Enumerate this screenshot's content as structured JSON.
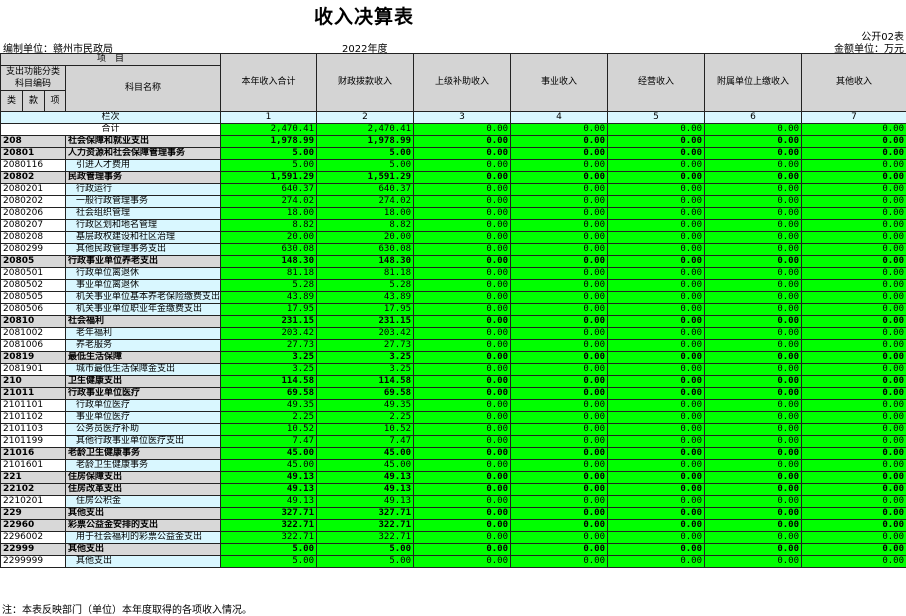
{
  "title": "收入决算表",
  "form_no": "公开02表",
  "meta": {
    "unit": "编制单位：赣州市民政局",
    "year": "2022年度",
    "money_unit": "金额单位：万元"
  },
  "header": {
    "project": "项　目",
    "func_class": "支出功能分类科目编码",
    "subject_name": "科目名称",
    "lei": "类",
    "kuan": "款",
    "xiang": "项",
    "index_label": "栏次",
    "total_label": "合计",
    "columns": [
      "本年收入合计",
      "财政拨款收入",
      "上级补助收入",
      "事业收入",
      "经营收入",
      "附属单位上缴收入",
      "其他收入"
    ],
    "index_numbers": [
      "1",
      "2",
      "3",
      "4",
      "5",
      "6",
      "7"
    ]
  },
  "total_row": {
    "v1": "2,470.41",
    "v2": "2,470.41",
    "v3": "0.00",
    "v4": "0.00",
    "v5": "0.00",
    "v6": "0.00",
    "v7": "0.00"
  },
  "rows": [
    {
      "code": "208",
      "name": "社会保障和就业支出",
      "v1": "1,978.99",
      "v2": "1,978.99",
      "cat": true
    },
    {
      "code": "20801",
      "name": "人力资源和社会保障管理事务",
      "v1": "5.00",
      "v2": "5.00",
      "cat": true
    },
    {
      "code": "2080116",
      "name": "引进人才费用",
      "v1": "5.00",
      "v2": "5.00",
      "cat": false
    },
    {
      "code": "20802",
      "name": "民政管理事务",
      "v1": "1,591.29",
      "v2": "1,591.29",
      "cat": true
    },
    {
      "code": "2080201",
      "name": "行政运行",
      "v1": "640.37",
      "v2": "640.37",
      "cat": false
    },
    {
      "code": "2080202",
      "name": "一般行政管理事务",
      "v1": "274.02",
      "v2": "274.02",
      "cat": false
    },
    {
      "code": "2080206",
      "name": "社会组织管理",
      "v1": "18.00",
      "v2": "18.00",
      "cat": false
    },
    {
      "code": "2080207",
      "name": "行政区划和地名管理",
      "v1": "8.82",
      "v2": "8.82",
      "cat": false
    },
    {
      "code": "2080208",
      "name": "基层政权建设和社区治理",
      "v1": "20.00",
      "v2": "20.00",
      "cat": false
    },
    {
      "code": "2080299",
      "name": "其他民政管理事务支出",
      "v1": "630.08",
      "v2": "630.08",
      "cat": false
    },
    {
      "code": "20805",
      "name": "行政事业单位养老支出",
      "v1": "148.30",
      "v2": "148.30",
      "cat": true
    },
    {
      "code": "2080501",
      "name": "行政单位离退休",
      "v1": "81.18",
      "v2": "81.18",
      "cat": false
    },
    {
      "code": "2080502",
      "name": "事业单位离退休",
      "v1": "5.28",
      "v2": "5.28",
      "cat": false
    },
    {
      "code": "2080505",
      "name": "机关事业单位基本养老保险缴费支出",
      "v1": "43.89",
      "v2": "43.89",
      "cat": false
    },
    {
      "code": "2080506",
      "name": "机关事业单位职业年金缴费支出",
      "v1": "17.95",
      "v2": "17.95",
      "cat": false
    },
    {
      "code": "20810",
      "name": "社会福利",
      "v1": "231.15",
      "v2": "231.15",
      "cat": true
    },
    {
      "code": "2081002",
      "name": "老年福利",
      "v1": "203.42",
      "v2": "203.42",
      "cat": false
    },
    {
      "code": "2081006",
      "name": "养老服务",
      "v1": "27.73",
      "v2": "27.73",
      "cat": false
    },
    {
      "code": "20819",
      "name": "最低生活保障",
      "v1": "3.25",
      "v2": "3.25",
      "cat": true
    },
    {
      "code": "2081901",
      "name": "城市最低生活保障金支出",
      "v1": "3.25",
      "v2": "3.25",
      "cat": false
    },
    {
      "code": "210",
      "name": "卫生健康支出",
      "v1": "114.58",
      "v2": "114.58",
      "cat": true
    },
    {
      "code": "21011",
      "name": "行政事业单位医疗",
      "v1": "69.58",
      "v2": "69.58",
      "cat": true
    },
    {
      "code": "2101101",
      "name": "行政单位医疗",
      "v1": "49.35",
      "v2": "49.35",
      "cat": false
    },
    {
      "code": "2101102",
      "name": "事业单位医疗",
      "v1": "2.25",
      "v2": "2.25",
      "cat": false
    },
    {
      "code": "2101103",
      "name": "公务员医疗补助",
      "v1": "10.52",
      "v2": "10.52",
      "cat": false
    },
    {
      "code": "2101199",
      "name": "其他行政事业单位医疗支出",
      "v1": "7.47",
      "v2": "7.47",
      "cat": false
    },
    {
      "code": "21016",
      "name": "老龄卫生健康事务",
      "v1": "45.00",
      "v2": "45.00",
      "cat": true
    },
    {
      "code": "2101601",
      "name": "老龄卫生健康事务",
      "v1": "45.00",
      "v2": "45.00",
      "cat": false
    },
    {
      "code": "221",
      "name": "住房保障支出",
      "v1": "49.13",
      "v2": "49.13",
      "cat": true
    },
    {
      "code": "22102",
      "name": "住房改革支出",
      "v1": "49.13",
      "v2": "49.13",
      "cat": true
    },
    {
      "code": "2210201",
      "name": "住房公积金",
      "v1": "49.13",
      "v2": "49.13",
      "cat": false
    },
    {
      "code": "229",
      "name": "其他支出",
      "v1": "327.71",
      "v2": "327.71",
      "cat": true
    },
    {
      "code": "22960",
      "name": "彩票公益金安排的支出",
      "v1": "322.71",
      "v2": "322.71",
      "cat": true
    },
    {
      "code": "2296002",
      "name": "用于社会福利的彩票公益金支出",
      "v1": "322.71",
      "v2": "322.71",
      "cat": false
    },
    {
      "code": "22999",
      "name": "其他支出",
      "v1": "5.00",
      "v2": "5.00",
      "cat": true
    },
    {
      "code": "2299999",
      "name": "其他支出",
      "v1": "5.00",
      "v2": "5.00",
      "cat": false
    }
  ],
  "zero": "0.00",
  "footnote": "注：本表反映部门（单位）本年度取得的各项收入情况。"
}
